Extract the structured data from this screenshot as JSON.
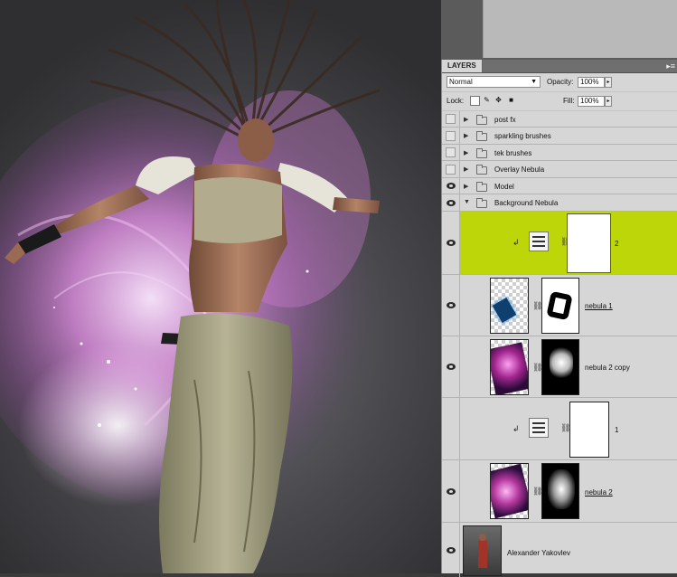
{
  "panel": {
    "tab_label": "LAYERS",
    "menu_icon": "panel-menu-icon",
    "blend_mode": "Normal",
    "opacity_label": "Opacity:",
    "opacity_value": "100%",
    "lock_label": "Lock:",
    "fill_label": "Fill:",
    "fill_value": "100%"
  },
  "layers": {
    "post_fx": "post fx",
    "sparkling_brushes": "sparkling brushes",
    "tek_brushes": "tek brushes",
    "overlay_nebula": "Overlay Nebula",
    "model": "Model",
    "background_nebula": "Background Nebula",
    "levels_2": "2",
    "nebula_1": "nebula 1",
    "nebula_2_copy": "nebula 2 copy",
    "levels_1": "1",
    "nebula_2": "nebula 2",
    "background": "Alexander Yakovlev"
  },
  "colors": {
    "selected_layer": "#bcd60a",
    "panel_bg": "#d6d6d6",
    "nebula_pink": "#e08ae0"
  }
}
